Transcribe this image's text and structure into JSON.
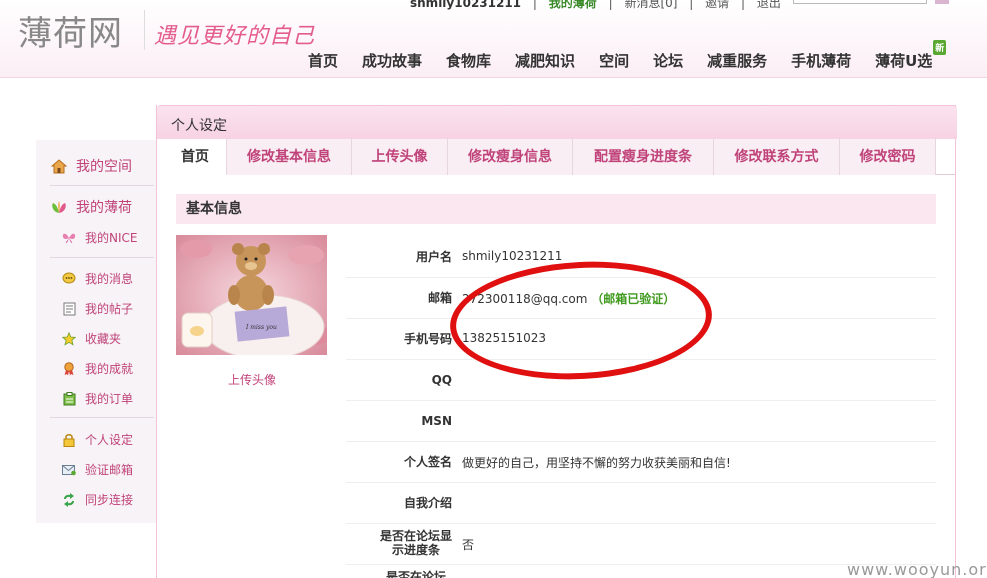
{
  "header": {
    "logo": "薄荷网",
    "slogan": "遇见更好的自己",
    "topbar": {
      "username": "shmily10231211",
      "my_boohee": "我的薄荷",
      "messages": "新消息[0]",
      "invite": "邀请",
      "logout": "退出"
    },
    "nav": [
      "首页",
      "成功故事",
      "食物库",
      "减肥知识",
      "空间",
      "论坛",
      "减重服务",
      "手机薄荷",
      "薄荷U选"
    ],
    "new_badge": "新"
  },
  "sidebar": {
    "my_space": "我的空间",
    "my_boohee": "我的薄荷",
    "items_group1": [
      {
        "label": "我的NICE",
        "icon": "butterfly-icon"
      }
    ],
    "items_group2": [
      {
        "label": "我的消息",
        "icon": "message-icon"
      },
      {
        "label": "我的帖子",
        "icon": "post-icon"
      },
      {
        "label": "收藏夹",
        "icon": "star-icon"
      },
      {
        "label": "我的成就",
        "icon": "medal-icon"
      },
      {
        "label": "我的订单",
        "icon": "order-icon"
      }
    ],
    "items_group3": [
      {
        "label": "个人设定",
        "icon": "lock-icon"
      },
      {
        "label": "验证邮箱",
        "icon": "mail-icon"
      },
      {
        "label": "同步连接",
        "icon": "sync-icon"
      }
    ]
  },
  "panel": {
    "title": "个人设定",
    "tabs": [
      "首页",
      "修改基本信息",
      "上传头像",
      "修改瘦身信息",
      "配置瘦身进度条",
      "修改联系方式",
      "修改密码"
    ],
    "active_tab": "首页",
    "section_title": "基本信息",
    "upload_avatar": "上传头像",
    "avatar_caption": "I miss you",
    "fields": [
      {
        "label": "用户名",
        "value": "shmily10231211"
      },
      {
        "label": "邮箱",
        "value": "272300118@qq.com",
        "note": "（邮箱已验证）"
      },
      {
        "label": "手机号码",
        "value": "13825151023"
      },
      {
        "label": "QQ",
        "value": ""
      },
      {
        "label": "MSN",
        "value": ""
      },
      {
        "label": "个人签名",
        "value": "做更好的自己，用坚持不懈的努力收获美丽和自信!"
      },
      {
        "label": "自我介绍",
        "value": ""
      },
      {
        "label": "是否在论坛显示进度条",
        "value": "否"
      },
      {
        "label": "是否在论坛",
        "value": ""
      }
    ]
  },
  "watermark": "www.wooyun.org",
  "colors": {
    "accent": "#c0437a",
    "verified": "#3f9a1e",
    "annotation": "#e01010"
  }
}
